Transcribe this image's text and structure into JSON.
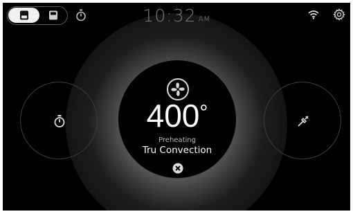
{
  "header": {
    "time": "10:32",
    "ampm": "AM",
    "oven_toggle": {
      "options": [
        "upper-oven",
        "lower-oven"
      ],
      "selected": "upper-oven"
    },
    "icons": [
      "timer-icon",
      "wifi-icon",
      "settings-gear-icon"
    ]
  },
  "dial": {
    "icon": "fan-icon",
    "temperature": "400",
    "degree_symbol": "°",
    "status": "Preheating",
    "mode": "Tru Convection",
    "cancel_icon": "close-icon"
  },
  "side_buttons": {
    "left_icon": "timer-icon",
    "right_icon": "probe-icon"
  },
  "colors": {
    "background": "#000000",
    "text_primary": "#ffffff",
    "text_muted": "#7a7a7a",
    "toggle_active": "#f0f0f0",
    "icon": "#dcdcdc"
  }
}
